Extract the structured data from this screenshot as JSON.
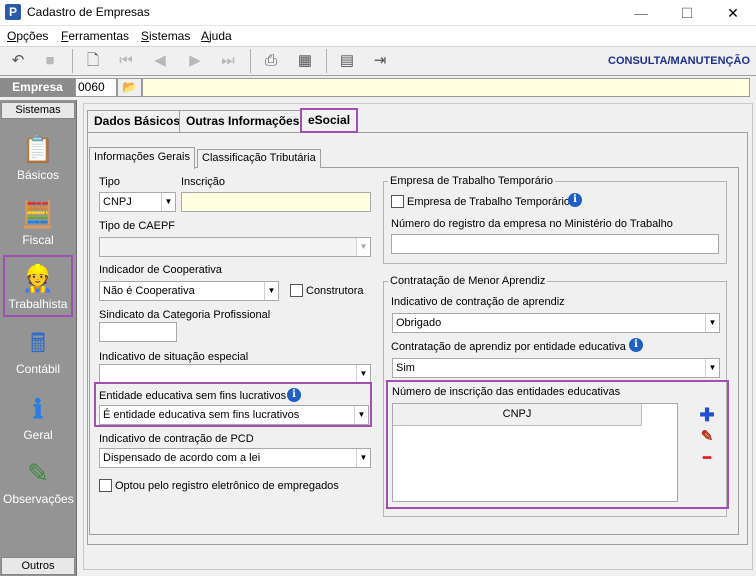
{
  "window": {
    "app_icon": "P",
    "title": "Cadastro de Empresas",
    "minimize": "—",
    "maximize": "☐",
    "close": "✕"
  },
  "menu": {
    "opcoes": {
      "u": "O",
      "rest": "pções"
    },
    "ferramentas": {
      "u": "F",
      "rest": "erramentas"
    },
    "sistemas": {
      "u": "S",
      "rest": "istemas"
    },
    "ajuda": {
      "u": "A",
      "rest": "juda"
    }
  },
  "toolbar": {
    "icons": [
      "undo-icon",
      "stop-icon",
      "preview-icon",
      "first-icon",
      "previous-icon",
      "next-icon",
      "last-icon",
      "print-icon",
      "report-icon",
      "calculator-icon",
      "exit-icon"
    ],
    "mode_label": "CONSULTA/MANUTENÇÃO"
  },
  "empresa": {
    "label": "Empresa",
    "code": "0060",
    "folder_icon": "📂",
    "name": ""
  },
  "sidebar": {
    "header": "Sistemas",
    "footer": "Outros",
    "items": [
      {
        "label": "Básicos",
        "icon": "basicos-icon",
        "glyph": "📋"
      },
      {
        "label": "Fiscal",
        "icon": "fiscal-icon",
        "glyph": "🧮"
      },
      {
        "label": "Trabalhista",
        "icon": "trabalhista-icon",
        "glyph": "👷"
      },
      {
        "label": "Contábil",
        "icon": "contabil-icon",
        "glyph": "🖩"
      },
      {
        "label": "Geral",
        "icon": "geral-icon",
        "glyph": "ℹ"
      },
      {
        "label": "Observações",
        "icon": "observacoes-icon",
        "glyph": "✎"
      }
    ]
  },
  "tabs": {
    "main": [
      "Dados Básicos",
      "Outras Informações",
      "eSocial"
    ],
    "sub": [
      "Informações Gerais",
      "Classificação Tributária"
    ]
  },
  "form": {
    "tipo_label": "Tipo",
    "tipo_value": "CNPJ",
    "inscricao_label": "Inscrição",
    "inscricao_value": "",
    "caepf_label": "Tipo de CAEPF",
    "caepf_value": "",
    "cooperativa_label": "Indicador de Cooperativa",
    "cooperativa_value": "Não é Cooperativa",
    "construtora_label": "Construtora",
    "construtora_checked": false,
    "sindicato_label": "Sindicato da Categoria Profissional",
    "sindicato_value": "",
    "situacao_label": "Indicativo de situação especial",
    "situacao_value": "",
    "entidade_label": "Entidade educativa sem fins lucrativos",
    "entidade_value": "É entidade educativa sem fins lucrativos",
    "pcd_label": "Indicativo de contração de PCD",
    "pcd_value": "Dispensado de acordo com a lei",
    "registro_label": "Optou pelo registro eletrônico de empregados",
    "registro_checked": false
  },
  "temporario": {
    "title": "Empresa de Trabalho Temporário",
    "checkbox_label": "Empresa de Trabalho Temporário",
    "checked": false,
    "registro_label": "Número do registro da empresa no Ministério do Trabalho",
    "registro_value": ""
  },
  "aprendiz": {
    "title": "Contratação de Menor Aprendiz",
    "indicativo_label": "Indicativo de contração de aprendiz",
    "indicativo_value": "Obrigado",
    "entidade_label": "Contratação de aprendiz por entidade educativa",
    "entidade_value": "Sim",
    "numero_label": "Número de inscrição das entidades educativas",
    "grid_column": "CNPJ",
    "add_glyph": "✚",
    "edit_glyph": "✎",
    "remove_glyph": "━"
  },
  "colors": {
    "highlight": "#a050b0",
    "yellow_field": "#ffffe1",
    "sidebar_bg": "#949494",
    "consulta_text": "#1d2f8c",
    "info_blue": "#1f5fc4"
  }
}
